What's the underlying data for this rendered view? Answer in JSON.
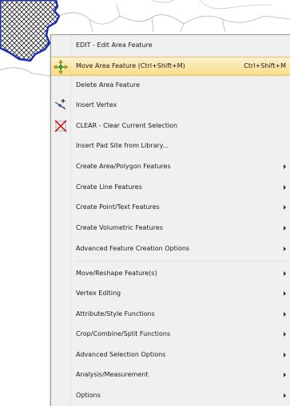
{
  "context_menu": {
    "items": [
      {
        "label": "EDIT - Edit Area Feature",
        "shortcut": "",
        "submenu": false,
        "icon": "",
        "highlighted": false
      },
      {
        "label": "Move Area Feature (Ctrl+Shift+M)",
        "shortcut": "Ctrl+Shift+M",
        "submenu": false,
        "icon": "move-arrows-icon",
        "highlighted": true
      },
      {
        "label": "Delete Area Feature",
        "shortcut": "",
        "submenu": false,
        "icon": "",
        "highlighted": false
      },
      {
        "label": "Insert Vertex",
        "shortcut": "",
        "submenu": false,
        "icon": "insert-vertex-icon",
        "highlighted": false
      },
      {
        "label": "CLEAR - Clear Current Selection",
        "shortcut": "",
        "submenu": false,
        "icon": "clear-selection-icon",
        "highlighted": false
      },
      {
        "label": "Insert Pad Site from Library...",
        "shortcut": "",
        "submenu": false,
        "icon": "",
        "highlighted": false
      },
      {
        "label": "Create Area/Polygon Features",
        "shortcut": "",
        "submenu": true,
        "icon": "",
        "highlighted": false
      },
      {
        "label": "Create Line Features",
        "shortcut": "",
        "submenu": true,
        "icon": "",
        "highlighted": false
      },
      {
        "label": "Create Point/Text Features",
        "shortcut": "",
        "submenu": true,
        "icon": "",
        "highlighted": false
      },
      {
        "label": "Create Volumetric Features",
        "shortcut": "",
        "submenu": true,
        "icon": "",
        "highlighted": false
      },
      {
        "label": "Advanced Feature Creation Options",
        "shortcut": "",
        "submenu": true,
        "icon": "",
        "highlighted": false
      },
      {
        "label": "Move/Reshape Feature(s)",
        "shortcut": "",
        "submenu": true,
        "icon": "",
        "highlighted": false
      },
      {
        "label": "Vertex Editing",
        "shortcut": "",
        "submenu": true,
        "icon": "",
        "highlighted": false
      },
      {
        "label": "Attribute/Style Functions",
        "shortcut": "",
        "submenu": true,
        "icon": "",
        "highlighted": false
      },
      {
        "label": "Crop/Combine/Split Functions",
        "shortcut": "",
        "submenu": true,
        "icon": "",
        "highlighted": false
      },
      {
        "label": "Advanced Selection Options",
        "shortcut": "",
        "submenu": true,
        "icon": "",
        "highlighted": false
      },
      {
        "label": "Analysis/Measurement",
        "shortcut": "",
        "submenu": true,
        "icon": "",
        "highlighted": false
      },
      {
        "label": "Options",
        "shortcut": "",
        "submenu": true,
        "icon": "",
        "highlighted": false
      }
    ]
  },
  "colors": {
    "menu_background": "#f0f0f0",
    "highlight": "#f8dd8a",
    "map_outline": "#1a2fb0"
  }
}
